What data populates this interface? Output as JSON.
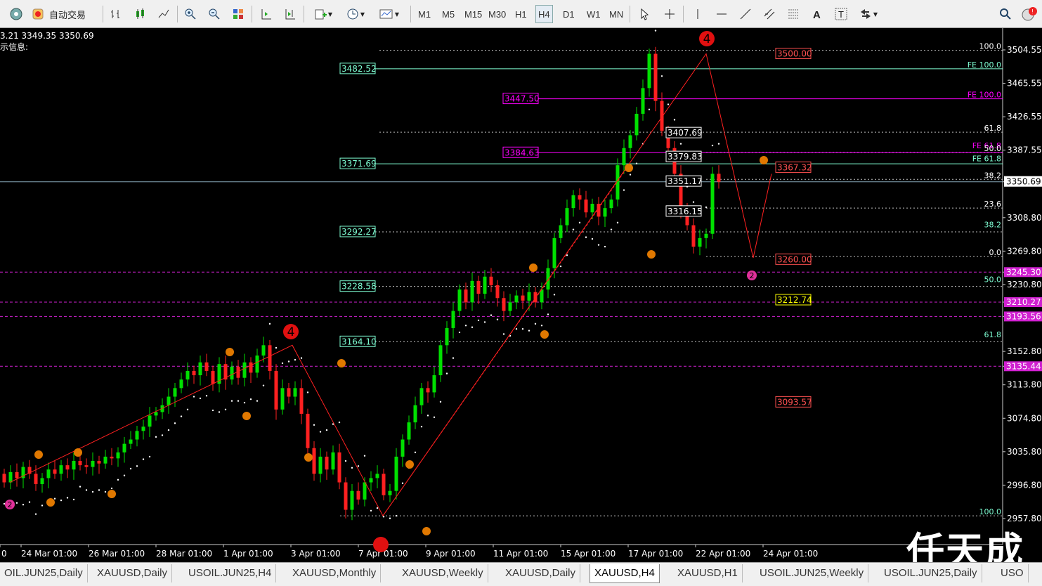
{
  "toolbar": {
    "auto_trade_label": "自动交易",
    "timeframes": [
      "M1",
      "M5",
      "M15",
      "M30",
      "H1",
      "H4",
      "D1",
      "W1",
      "MN"
    ],
    "active_timeframe": "H4"
  },
  "info_line1": "3.21 3349.35 3350.69",
  "info_line2": "示信息:",
  "price_axis": {
    "labels": [
      "3504.55",
      "3465.55",
      "3426.55",
      "3387.55",
      "3350.69",
      "3308.80",
      "3269.80",
      "3245.30",
      "3230.80",
      "3210.27",
      "3193.56",
      "3152.80",
      "3135.44",
      "3113.80",
      "3074.80",
      "3035.80",
      "2996.80",
      "2957.80"
    ]
  },
  "time_axis": {
    "labels": [
      "0",
      "24 Mar 01:00",
      "26 Mar 01:00",
      "28 Mar 01:00",
      "1 Apr 01:00",
      "3 Apr 01:00",
      "7 Apr 01:00",
      "9 Apr 01:00",
      "11 Apr 01:00",
      "15 Apr 01:00",
      "17 Apr 01:00",
      "22 Apr 01:00",
      "24 Apr 01:00"
    ]
  },
  "chart_data": {
    "type": "candlestick",
    "symbol_tab": "XAUUSD,H4",
    "current_price": 3350.69,
    "ylim": [
      2957.8,
      3504.55
    ],
    "levels": [
      {
        "label": "3482.52",
        "price": 3482.52,
        "color": "#7fffd4"
      },
      {
        "label": "3447.50",
        "price": 3447.5,
        "color": "#ff00ff"
      },
      {
        "label": "3407.69",
        "price": 3407.69,
        "color": "#ffffff"
      },
      {
        "label": "3384.63",
        "price": 3384.63,
        "color": "#ff00ff"
      },
      {
        "label": "3379.83",
        "price": 3379.83,
        "color": "#ffffff"
      },
      {
        "label": "3371.69",
        "price": 3371.69,
        "color": "#7fffd4"
      },
      {
        "label": "3367.32",
        "price": 3367.32,
        "color": "#ff5050"
      },
      {
        "label": "3351.17",
        "price": 3351.17,
        "color": "#ffffff"
      },
      {
        "label": "3316.15",
        "price": 3316.15,
        "color": "#ffffff"
      },
      {
        "label": "3292.27",
        "price": 3292.27,
        "color": "#7fffd4"
      },
      {
        "label": "3260.00",
        "price": 3260.0,
        "color": "#ff5050"
      },
      {
        "label": "3228.58",
        "price": 3228.58,
        "color": "#7fffd4"
      },
      {
        "label": "3212.74",
        "price": 3212.74,
        "color": "#ffff00"
      },
      {
        "label": "3164.10",
        "price": 3164.1,
        "color": "#7fffd4"
      },
      {
        "label": "3093.57",
        "price": 3093.57,
        "color": "#ff5050"
      },
      {
        "label": "3500.00",
        "price": 3500.0,
        "color": "#ff5050"
      }
    ],
    "fib_labels": [
      {
        "text": "100.0",
        "price": 3504.0,
        "color": "#ffffff"
      },
      {
        "text": "FE 100.0",
        "price": 3482.5,
        "color": "#7fffd4"
      },
      {
        "text": "FE 100.0",
        "price": 3447.5,
        "color": "#ff00ff"
      },
      {
        "text": "61.8",
        "price": 3408.5,
        "color": "#ffffff"
      },
      {
        "text": "FE 61.8",
        "price": 3388.0,
        "color": "#ff00ff"
      },
      {
        "text": "50.0",
        "price": 3385.0,
        "color": "#ffffff"
      },
      {
        "text": "FE 61.8",
        "price": 3373.0,
        "color": "#7fffd4"
      },
      {
        "text": "38.2",
        "price": 3353.5,
        "color": "#ffffff"
      },
      {
        "text": "23.6",
        "price": 3320.0,
        "color": "#ffffff"
      },
      {
        "text": "38.2",
        "price": 3296.0,
        "color": "#7fffd4"
      },
      {
        "text": "0.0",
        "price": 3263.5,
        "color": "#ffffff"
      },
      {
        "text": "50.0",
        "price": 3232.0,
        "color": "#7fffd4"
      },
      {
        "text": "61.8",
        "price": 3167.5,
        "color": "#7fffd4"
      },
      {
        "text": "100.0",
        "price": 2961.0,
        "color": "#7fffd4"
      }
    ],
    "wave_labels": [
      {
        "text": "4",
        "big": true
      },
      {
        "text": "4",
        "big": true
      },
      {
        "text": "2",
        "big": false
      },
      {
        "text": "2",
        "big": false
      }
    ]
  },
  "tabs": [
    "OIL.JUN25,Daily",
    "XAUUSD,Daily",
    "USOIL.JUN25,H4",
    "XAUUSD,Monthly",
    "XAUUSD,Weekly",
    "XAUUSD,Daily",
    "XAUUSD,H4",
    "XAUUSD,H1",
    "USOIL.JUN25,Weekly",
    "USOIL.JUN25,Daily",
    "USO"
  ],
  "active_tab": "XAUUSD,H4",
  "watermark": "任天成",
  "colors": {
    "bull": "#00e000",
    "bear": "#ff2020",
    "sar": "#ffffff",
    "zigzag": "#ff2020",
    "wave_orange": "#e07800",
    "wave_magenta": "#e0309a"
  }
}
